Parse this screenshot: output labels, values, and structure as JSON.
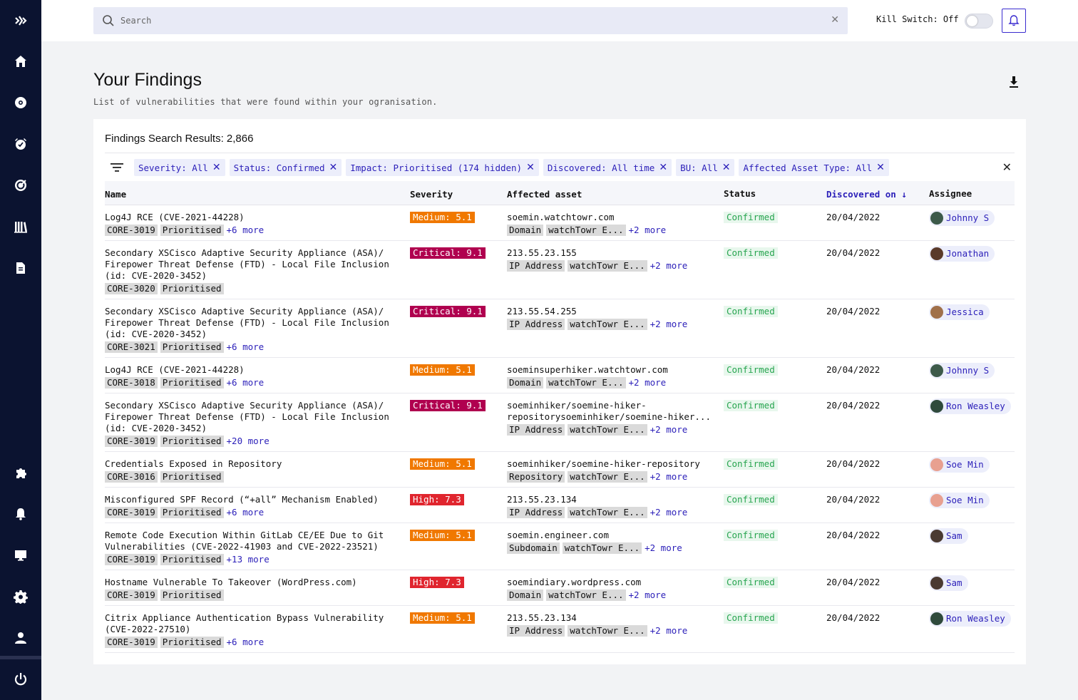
{
  "app": {
    "search_placeholder": "Search",
    "kill_switch_label": "Kill Switch: Off",
    "kill_switch_on": false,
    "accent_color": "#2b1fb9"
  },
  "sidebar": {
    "icons": [
      "logo-icon",
      "home-icon",
      "eye-icon",
      "alarm-icon",
      "target-icon",
      "library-icon",
      "document-icon",
      "puzzle-icon",
      "bell-icon",
      "monitor-icon",
      "gear-icon",
      "user-icon",
      "power-icon"
    ]
  },
  "page": {
    "title": "Your Findings",
    "subtitle": "List of vulnerabilities that were found within your ogranisation."
  },
  "results": {
    "title": "Findings Search Results: 2,866"
  },
  "filters": [
    {
      "label": "Severity: All"
    },
    {
      "label": "Status: Confirmed"
    },
    {
      "label": "Impact: Prioritised (174 hidden)"
    },
    {
      "label": "Discovered: All time"
    },
    {
      "label": "BU: All"
    },
    {
      "label": "Affected Asset Type: All"
    }
  ],
  "columns": {
    "name": "Name",
    "severity": "Severity",
    "asset": "Affected asset",
    "status": "Status",
    "discovered": "Discovered on ↓",
    "assignee": "Assignee"
  },
  "rows": [
    {
      "name": "Log4J RCE (CVE-2021-44228)",
      "id": "CORE-3019",
      "impact": "Prioritised",
      "more": "+6 more",
      "severity": "Medium: 5.1",
      "sev_level": "medium",
      "asset": "soemin.watchtowr.com",
      "asset_type": "Domain",
      "asset_owner": "watchTowr E...",
      "asset_more": "+2 more",
      "status": "Confirmed",
      "date": "20/04/2022",
      "assignee": "Johnny S",
      "avatar_color": "#3d5a4a"
    },
    {
      "name": "Secondary XSCisco Adaptive Security Appliance (ASA)/ Firepower Threat Defense (FTD) - Local File Inclusion (id: CVE-2020-3452)",
      "id": "CORE-3020",
      "impact": "Prioritised",
      "more": "",
      "severity": "Critical: 9.1",
      "sev_level": "critical",
      "asset": "213.55.23.155",
      "asset_type": "IP Address",
      "asset_owner": "watchTowr E...",
      "asset_more": "+2 more",
      "status": "Confirmed",
      "date": "20/04/2022",
      "assignee": "Jonathan",
      "avatar_color": "#5a3a2a"
    },
    {
      "name": "Secondary XSCisco Adaptive Security Appliance (ASA)/ Firepower Threat Defense (FTD) - Local File Inclusion (id: CVE-2020-3452)",
      "id": "CORE-3021",
      "impact": "Prioritised",
      "more": "+6 more",
      "severity": "Critical: 9.1",
      "sev_level": "critical",
      "asset": "213.55.54.255",
      "asset_type": "IP Address",
      "asset_owner": "watchTowr E...",
      "asset_more": "+2 more",
      "status": "Confirmed",
      "date": "20/04/2022",
      "assignee": "Jessica",
      "avatar_color": "#a0704a"
    },
    {
      "name": "Log4J RCE (CVE-2021-44228)",
      "id": "CORE-3018",
      "impact": "Prioritised",
      "more": "+6 more",
      "severity": "Medium: 5.1",
      "sev_level": "medium",
      "asset": "soeminsuperhiker.watchtowr.com",
      "asset_type": "Domain",
      "asset_owner": "watchTowr E...",
      "asset_more": "+2 more",
      "status": "Confirmed",
      "date": "20/04/2022",
      "assignee": "Johnny S",
      "avatar_color": "#3d5a4a"
    },
    {
      "name": "Secondary XSCisco Adaptive Security Appliance (ASA)/ Firepower Threat Defense (FTD) - Local File Inclusion (id: CVE-2020-3452)",
      "id": "CORE-3019",
      "impact": "Prioritised",
      "more": "+20 more",
      "severity": "Critical: 9.1",
      "sev_level": "critical",
      "asset": "soeminhiker/soemine-hiker-repositorysoeminhiker/soemine-hiker...",
      "asset_type": "IP Address",
      "asset_owner": "watchTowr E...",
      "asset_more": "+2 more",
      "status": "Confirmed",
      "date": "20/04/2022",
      "assignee": "Ron Weasley",
      "avatar_color": "#2f4a3c"
    },
    {
      "name": "Credentials Exposed in Repository",
      "id": "CORE-3016",
      "impact": "Prioritised",
      "more": "",
      "severity": "Medium: 5.1",
      "sev_level": "medium",
      "asset": "soeminhiker/soemine-hiker-repository",
      "asset_type": "Repository",
      "asset_owner": "watchTowr E...",
      "asset_more": "+2 more",
      "status": "Confirmed",
      "date": "20/04/2022",
      "assignee": "Soe Min",
      "avatar_color": "#e8a090"
    },
    {
      "name": "Misconfigured SPF Record (“+all” Mechanism Enabled)",
      "id": "CORE-3019",
      "impact": "Prioritised",
      "more": "+6 more",
      "severity": "High: 7.3",
      "sev_level": "high",
      "asset": "213.55.23.134",
      "asset_type": "IP Address",
      "asset_owner": "watchTowr E...",
      "asset_more": "+2 more",
      "status": "Confirmed",
      "date": "20/04/2022",
      "assignee": "Soe Min",
      "avatar_color": "#e8a090"
    },
    {
      "name": "Remote Code Execution Within GitLab CE/EE Due to Git Vulnerabilities (CVE-2022-41903 and CVE-2022-23521)",
      "id": "CORE-3019",
      "impact": "Prioritised",
      "more": "+13 more",
      "severity": "Medium: 5.1",
      "sev_level": "medium",
      "asset": "soemin.engineer.com",
      "asset_type": "Subdomain",
      "asset_owner": "watchTowr E...",
      "asset_more": "+2 more",
      "status": "Confirmed",
      "date": "20/04/2022",
      "assignee": "Sam",
      "avatar_color": "#4a3a32"
    },
    {
      "name": "Hostname Vulnerable To Takeover (WordPress.com)",
      "id": "CORE-3019",
      "impact": "Prioritised",
      "more": "",
      "severity": "High: 7.3",
      "sev_level": "high",
      "asset": "soemindiary.wordpress.com",
      "asset_type": "Domain",
      "asset_owner": "watchTowr E...",
      "asset_more": "+2 more",
      "status": "Confirmed",
      "date": "20/04/2022",
      "assignee": "Sam",
      "avatar_color": "#4a3a32"
    },
    {
      "name": "Citrix Appliance Authentication Bypass Vulnerability (CVE-2022-27510)",
      "id": "CORE-3019",
      "impact": "Prioritised",
      "more": "+6 more",
      "severity": "Medium: 5.1",
      "sev_level": "medium",
      "asset": "213.55.23.134",
      "asset_type": "IP Address",
      "asset_owner": "watchTowr E...",
      "asset_more": "+2 more",
      "status": "Confirmed",
      "date": "20/04/2022",
      "assignee": "Ron Weasley",
      "avatar_color": "#2f4a3c"
    }
  ]
}
